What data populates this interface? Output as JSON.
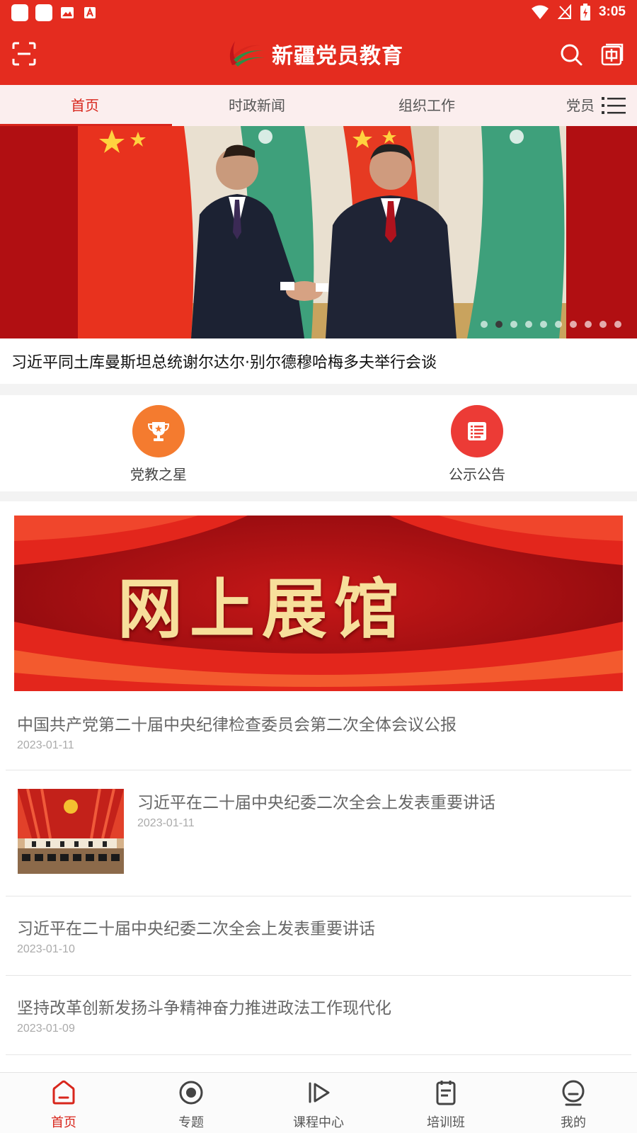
{
  "status_bar": {
    "time": "3:05"
  },
  "app_bar": {
    "title": "新疆党员教育",
    "scan_icon": "scan-icon",
    "search_icon": "search-icon",
    "language_icon": "chinese-language-icon"
  },
  "tabs": [
    {
      "label": "首页",
      "active": true
    },
    {
      "label": "时政新闻",
      "active": false
    },
    {
      "label": "组织工作",
      "active": false
    },
    {
      "label": "党员",
      "active": false
    }
  ],
  "banner": {
    "caption": "习近平同土库曼斯坦总统谢尔达尔·别尔德穆哈梅多夫举行会谈",
    "slide_count": 10,
    "active_slide": 2
  },
  "shortcuts": [
    {
      "label": "党教之星",
      "icon": "trophy-icon",
      "color": "#f47b2f"
    },
    {
      "label": "公示公告",
      "icon": "list-icon",
      "color": "#ec3b36"
    }
  ],
  "exhibit_banner": {
    "text": "网上展馆"
  },
  "news": [
    {
      "title": "中国共产党第二十届中央纪律检查委员会第二次全体会议公报",
      "date": "2023-01-11"
    },
    {
      "title": "习近平在二十届中央纪委二次全会上发表重要讲话",
      "date": "2023-01-11"
    },
    {
      "title": "习近平在二十届中央纪委二次全会上发表重要讲话",
      "date": "2023-01-10"
    },
    {
      "title": "坚持改革创新发扬斗争精神奋力推进政法工作现代化",
      "date": "2023-01-09"
    }
  ],
  "bottom_nav": [
    {
      "label": "首页",
      "icon": "home-icon",
      "active": true
    },
    {
      "label": "专题",
      "icon": "topic-icon",
      "active": false
    },
    {
      "label": "课程中心",
      "icon": "play-icon",
      "active": false
    },
    {
      "label": "培训班",
      "icon": "notebook-icon",
      "active": false
    },
    {
      "label": "我的",
      "icon": "profile-icon",
      "active": false
    }
  ],
  "colors": {
    "brand_red": "#e42c1f",
    "active_red": "#d8261c"
  }
}
